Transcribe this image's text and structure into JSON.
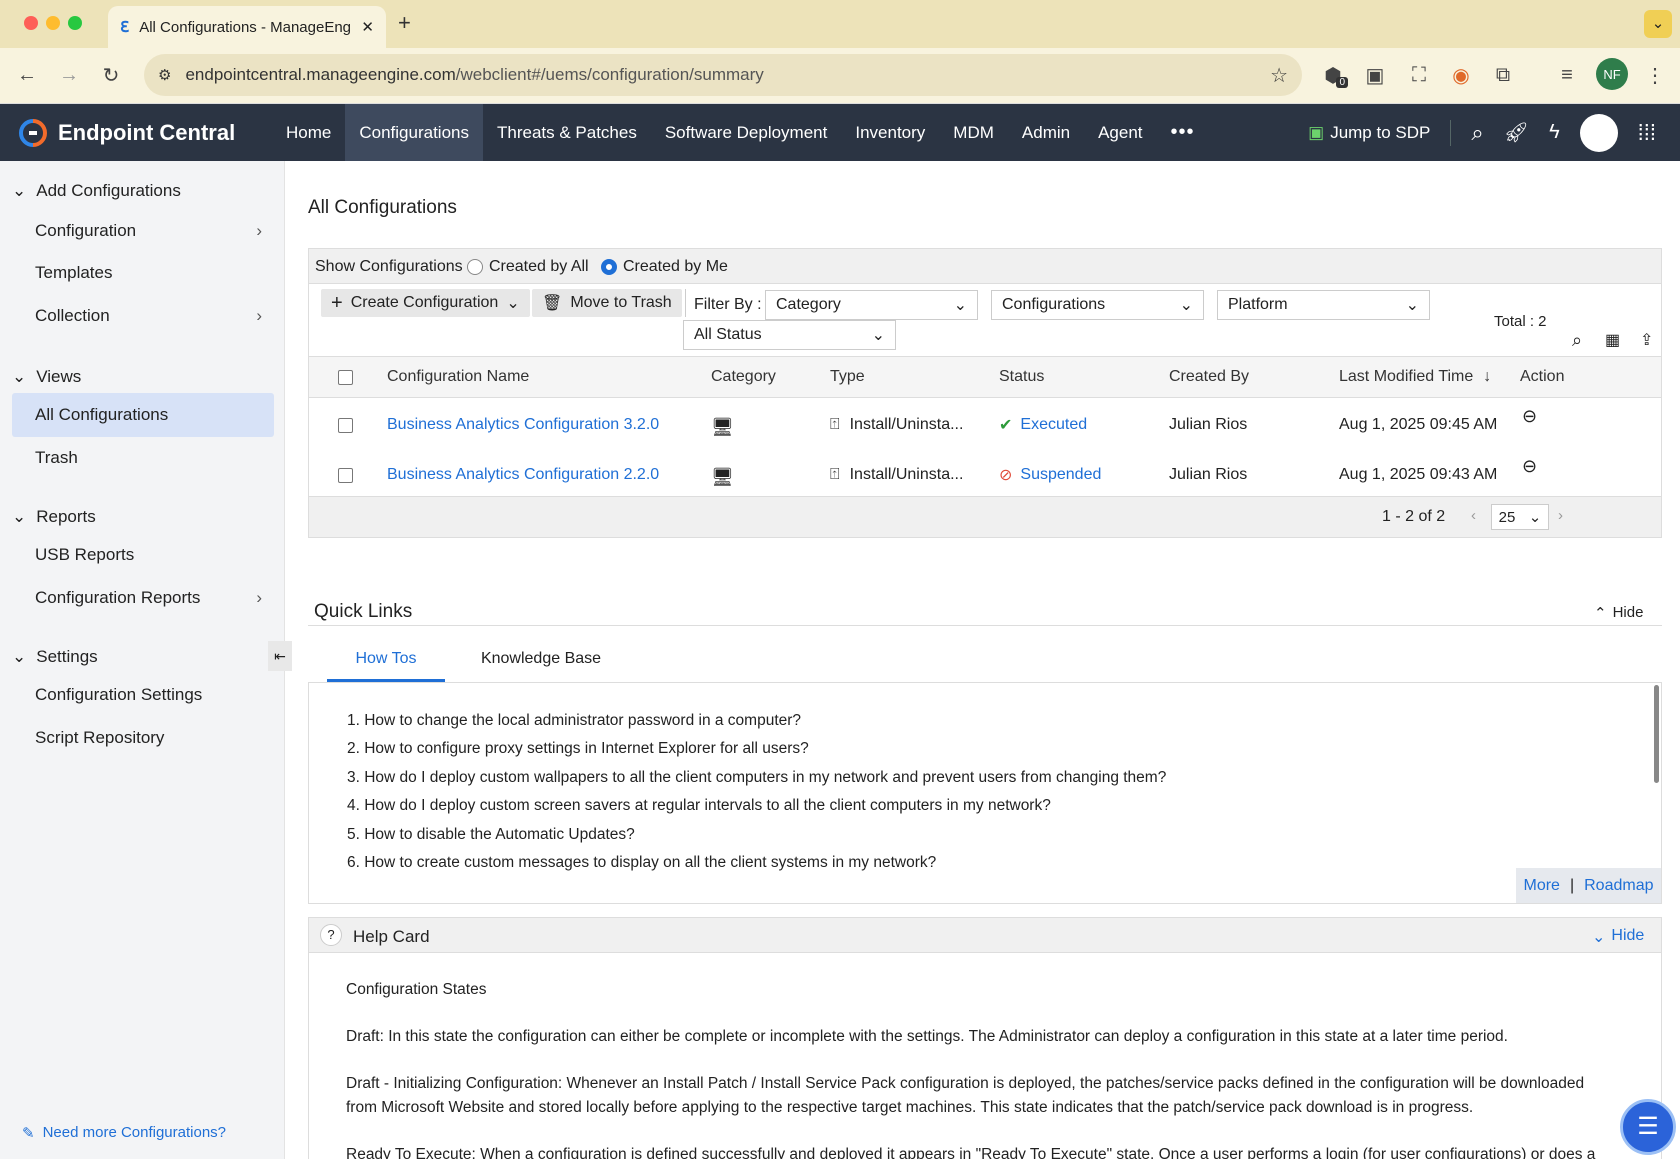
{
  "browser": {
    "tab_title": "All Configurations - ManageEngine",
    "url_domain": "endpointcentral.manageengine.com",
    "url_path": "/webclient#/uems/configuration/summary",
    "extension_badge": "0",
    "profile_initials": "NF"
  },
  "header": {
    "brand": "Endpoint Central",
    "nav": [
      "Home",
      "Configurations",
      "Threats & Patches",
      "Software Deployment",
      "Inventory",
      "MDM",
      "Admin",
      "Agent"
    ],
    "more": "•••",
    "jump": "Jump to SDP"
  },
  "sidebar": {
    "add_configs": "Add Configurations",
    "configuration": "Configuration",
    "templates": "Templates",
    "collection": "Collection",
    "views": "Views",
    "all_configurations": "All Configurations",
    "trash": "Trash",
    "reports": "Reports",
    "usb_reports": "USB Reports",
    "config_reports": "Configuration Reports",
    "settings": "Settings",
    "config_settings": "Configuration Settings",
    "script_repo": "Script Repository",
    "need_more": "Need more Configurations?"
  },
  "main": {
    "title": "All Configurations",
    "show_label": "Show Configurations :",
    "created_by_all": "Created by All",
    "created_by_me": "Created by Me",
    "create_btn": "Create Configuration",
    "trash_btn": "Move to Trash",
    "filter_by": "Filter By :",
    "category_filter": "Category",
    "configs_filter": "Configurations",
    "platform_filter": "Platform",
    "status_filter": "All Status",
    "total": "Total : 2",
    "columns": [
      "Configuration Name",
      "Category",
      "Type",
      "Status",
      "Created By",
      "Last Modified Time",
      "Action"
    ],
    "rows": [
      {
        "name": "Business Analytics Configuration 3.2.0",
        "type": "Install/Uninsta...",
        "status": "Executed",
        "created_by": "Julian Rios",
        "modified": "Aug 1, 2025 09:45 AM"
      },
      {
        "name": "Business Analytics Configuration 2.2.0",
        "type": "Install/Uninsta...",
        "status": "Suspended",
        "created_by": "Julian Rios",
        "modified": "Aug 1, 2025 09:43 AM"
      }
    ],
    "pagination": "1 - 2 of 2",
    "per_page": "25"
  },
  "quick_links": {
    "title": "Quick Links",
    "hide": "Hide",
    "tabs": [
      "How Tos",
      "Knowledge Base"
    ],
    "items": [
      "1. How to change the local administrator password in a computer?",
      "2. How to configure proxy settings in Internet Explorer for all users?",
      "3. How do I deploy custom wallpapers to all the client computers in my network and prevent users from changing them?",
      "4. How do I deploy custom screen savers at regular intervals to all the client computers in my network?",
      "5. How to disable the Automatic Updates?",
      "6. How to create custom messages to display on all the client systems in my network?"
    ],
    "more": "More",
    "sep": "|",
    "roadmap": "Roadmap"
  },
  "help_card": {
    "title": "Help Card",
    "hide": "Hide",
    "heading": "Configuration States",
    "p1": "Draft: In this state the configuration can either be complete or incomplete with the settings. The Administrator can deploy a configuration in this state at a later time period.",
    "p2": "Draft - Initializing Configuration: Whenever an Install Patch / Install Service Pack configuration is deployed, the patches/service packs defined in the configuration will be downloaded from Microsoft Website and stored locally before applying to the respective target machines. This state indicates that the patch/service pack download is in progress.",
    "p3": "Ready To Execute: When a configuration is defined successfully and deployed it appears in \"Ready To Execute\" state. Once a user performs a login (for user configurations) or does a startup of"
  },
  "colors": {
    "accent": "#1f6fd6",
    "header_bg": "#2b3443",
    "executed": "#2e9b3a",
    "suspended": "#e04b3a"
  }
}
